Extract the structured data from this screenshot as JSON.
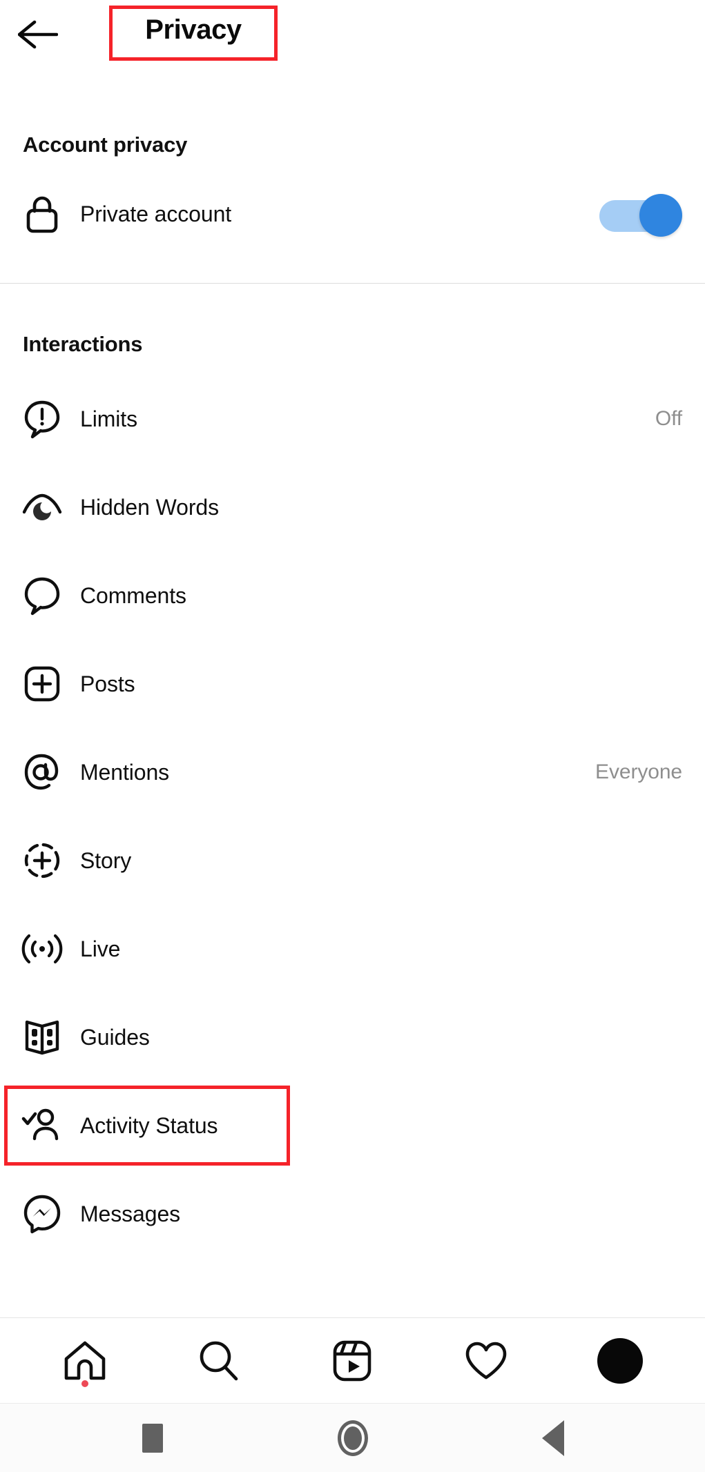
{
  "header": {
    "title": "Privacy",
    "back_icon": "arrow-left-icon",
    "highlight_color": "#f5232a"
  },
  "sections": [
    {
      "id": "account-privacy",
      "title": "Account privacy",
      "rows": [
        {
          "label": "Private account",
          "icon": "lock-icon",
          "control": "toggle",
          "toggle_on": true,
          "toggle_track_color": "#a5cdf5",
          "toggle_thumb_color": "#2f85e0"
        }
      ]
    },
    {
      "id": "interactions",
      "title": "Interactions",
      "rows": [
        {
          "label": "Limits",
          "icon": "limits-icon",
          "value": "Off"
        },
        {
          "label": "Hidden Words",
          "icon": "hidden-words-icon",
          "value": ""
        },
        {
          "label": "Comments",
          "icon": "comment-bubble-icon",
          "value": ""
        },
        {
          "label": "Posts",
          "icon": "plus-square-icon",
          "value": ""
        },
        {
          "label": "Mentions",
          "icon": "at-sign-icon",
          "value": "Everyone"
        },
        {
          "label": "Story",
          "icon": "story-plus-icon",
          "value": ""
        },
        {
          "label": "Live",
          "icon": "live-broadcast-icon",
          "value": ""
        },
        {
          "label": "Guides",
          "icon": "guides-book-icon",
          "value": ""
        },
        {
          "label": "Activity Status",
          "icon": "person-check-icon",
          "value": "",
          "highlighted": true
        },
        {
          "label": "Messages",
          "icon": "messenger-icon",
          "value": ""
        }
      ]
    }
  ],
  "bottom_nav": {
    "items": [
      {
        "name": "home",
        "icon": "home-icon",
        "badge_dot": true,
        "badge_color": "#ed4956"
      },
      {
        "name": "search",
        "icon": "search-icon",
        "badge_dot": false
      },
      {
        "name": "reels",
        "icon": "reels-icon",
        "badge_dot": false
      },
      {
        "name": "activity",
        "icon": "heart-icon",
        "badge_dot": false
      },
      {
        "name": "profile",
        "icon": "avatar-icon",
        "badge_dot": false
      }
    ]
  },
  "system_nav": {
    "items": [
      {
        "name": "recents",
        "icon": "square-icon"
      },
      {
        "name": "home",
        "icon": "circle-icon"
      },
      {
        "name": "back",
        "icon": "triangle-left-icon"
      }
    ]
  }
}
